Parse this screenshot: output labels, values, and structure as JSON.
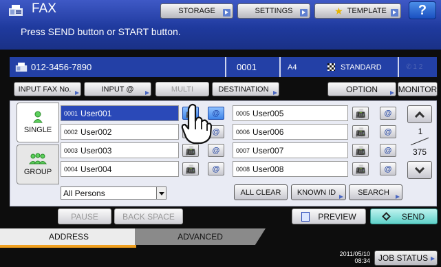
{
  "header": {
    "title": "FAX",
    "message": "Press SEND button or START button.",
    "buttons": {
      "storage": "STORAGE",
      "settings": "SETTINGS",
      "template": "TEMPLATE",
      "help": "?"
    }
  },
  "info": {
    "fax_number": "012-3456-7890",
    "count": "0001",
    "paper": "A4",
    "resolution": "STANDARD",
    "lines": "1  2"
  },
  "toolbar": {
    "input_fax": "INPUT FAX No.",
    "input_at": "INPUT @",
    "multi": "MULTI",
    "destination": "DESTINATION",
    "option": "OPTION",
    "monitor": "MONITOR"
  },
  "side_tabs": {
    "single": "SINGLE",
    "group": "GROUP"
  },
  "address_list": [
    {
      "num": "0001",
      "name": "User001"
    },
    {
      "num": "0002",
      "name": "User002"
    },
    {
      "num": "0003",
      "name": "User003"
    },
    {
      "num": "0004",
      "name": "User004"
    },
    {
      "num": "0005",
      "name": "User005"
    },
    {
      "num": "0006",
      "name": "User006"
    },
    {
      "num": "0007",
      "name": "User007"
    },
    {
      "num": "0008",
      "name": "User008"
    }
  ],
  "pager": {
    "current": "1",
    "total": "375"
  },
  "filter": {
    "selected": "All Persons"
  },
  "actions": {
    "all_clear": "ALL CLEAR",
    "known_id": "KNOWN ID",
    "search": "SEARCH"
  },
  "lower": {
    "pause": "PAUSE",
    "backspace": "BACK SPACE",
    "preview": "PREVIEW",
    "send": "SEND"
  },
  "bottom_tabs": {
    "address": "ADDRESS",
    "advanced": "ADVANCED"
  },
  "footer": {
    "date": "2011/05/10",
    "time": "08:34",
    "job_status": "JOB STATUS"
  },
  "colors": {
    "header_blue": "#1f3a9e",
    "info_blue": "#2340a6",
    "selected_row": "#2a49b8",
    "send_teal": "#5fd1c9",
    "accent_orange": "#f0a020"
  }
}
